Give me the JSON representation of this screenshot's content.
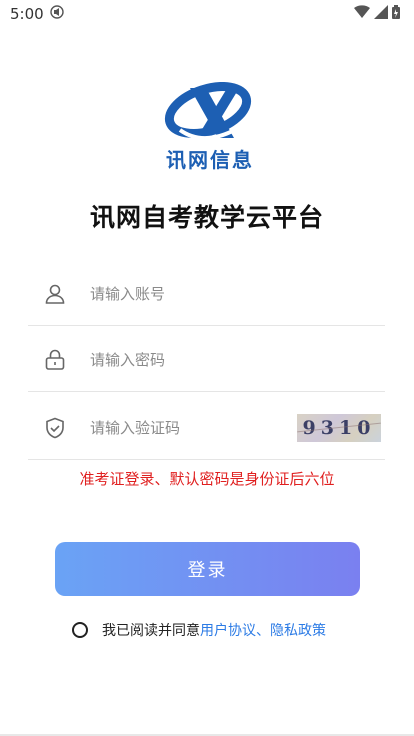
{
  "status": {
    "time": "5:00"
  },
  "brand": {
    "logo_text": "讯网信息",
    "logo_letter": "X"
  },
  "app_title": "讯网自考教学云平台",
  "form": {
    "account_placeholder": "请输入账号",
    "password_placeholder": "请输入密码",
    "captcha_placeholder": "请输入验证码",
    "captcha_code": "9310"
  },
  "warning": "准考证登录、默认密码是身份证后六位",
  "login_label": "登录",
  "agreement": {
    "prefix": "我已阅读并同意",
    "user_agreement": "用户协议",
    "separator": "、",
    "privacy_policy": "隐私政策"
  },
  "colors": {
    "accent_blue": "#1d5fb3",
    "link": "#2c7be5",
    "warning": "#e02020"
  }
}
